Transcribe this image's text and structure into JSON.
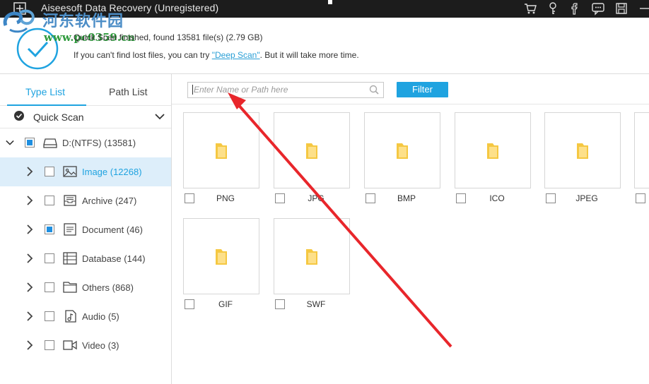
{
  "window": {
    "title": "Aiseesoft Data Recovery (Unregistered)",
    "toolbar_icons": [
      "cart-icon",
      "key-icon",
      "facebook-icon",
      "feedback-icon",
      "save-icon"
    ]
  },
  "watermark": {
    "site_name": "河东软件园",
    "url": "www.pc0359.cn"
  },
  "status": {
    "line1": "Quick Scan finished, found 13581 file(s) (2.79 GB)",
    "line2_prefix": "If you can't find lost files, you can try ",
    "deep_scan_link": "\"Deep Scan\"",
    "line2_suffix": ". But it will take more time."
  },
  "sidebar": {
    "tabs": [
      "Type List",
      "Path List"
    ],
    "active_tab": "Type List",
    "scan_mode": "Quick Scan",
    "drive": {
      "label": "D:(NTFS) (13581)",
      "checked": true
    },
    "items": [
      {
        "label": "Image (12268)",
        "icon": "image-icon",
        "checked": false,
        "selected": true
      },
      {
        "label": "Archive (247)",
        "icon": "archive-icon",
        "checked": false,
        "selected": false
      },
      {
        "label": "Document (46)",
        "icon": "document-icon",
        "checked": true,
        "selected": false
      },
      {
        "label": "Database (144)",
        "icon": "database-icon",
        "checked": false,
        "selected": false
      },
      {
        "label": "Others (868)",
        "icon": "folder-icon",
        "checked": false,
        "selected": false
      },
      {
        "label": "Audio (5)",
        "icon": "audio-icon",
        "checked": false,
        "selected": false
      },
      {
        "label": "Video (3)",
        "icon": "video-icon",
        "checked": false,
        "selected": false
      }
    ]
  },
  "main": {
    "search_placeholder": "Enter Name or Path here",
    "filter_label": "Filter",
    "folders": [
      "PNG",
      "JPG",
      "BMP",
      "ICO",
      "JPEG",
      "GIF",
      "SWF"
    ]
  },
  "colors": {
    "accent": "#1fa3e0",
    "titlebar": "#1c1c1c",
    "selected_row": "#ddeefa",
    "folder": "#f5c842",
    "annotation": "#e8262b"
  }
}
